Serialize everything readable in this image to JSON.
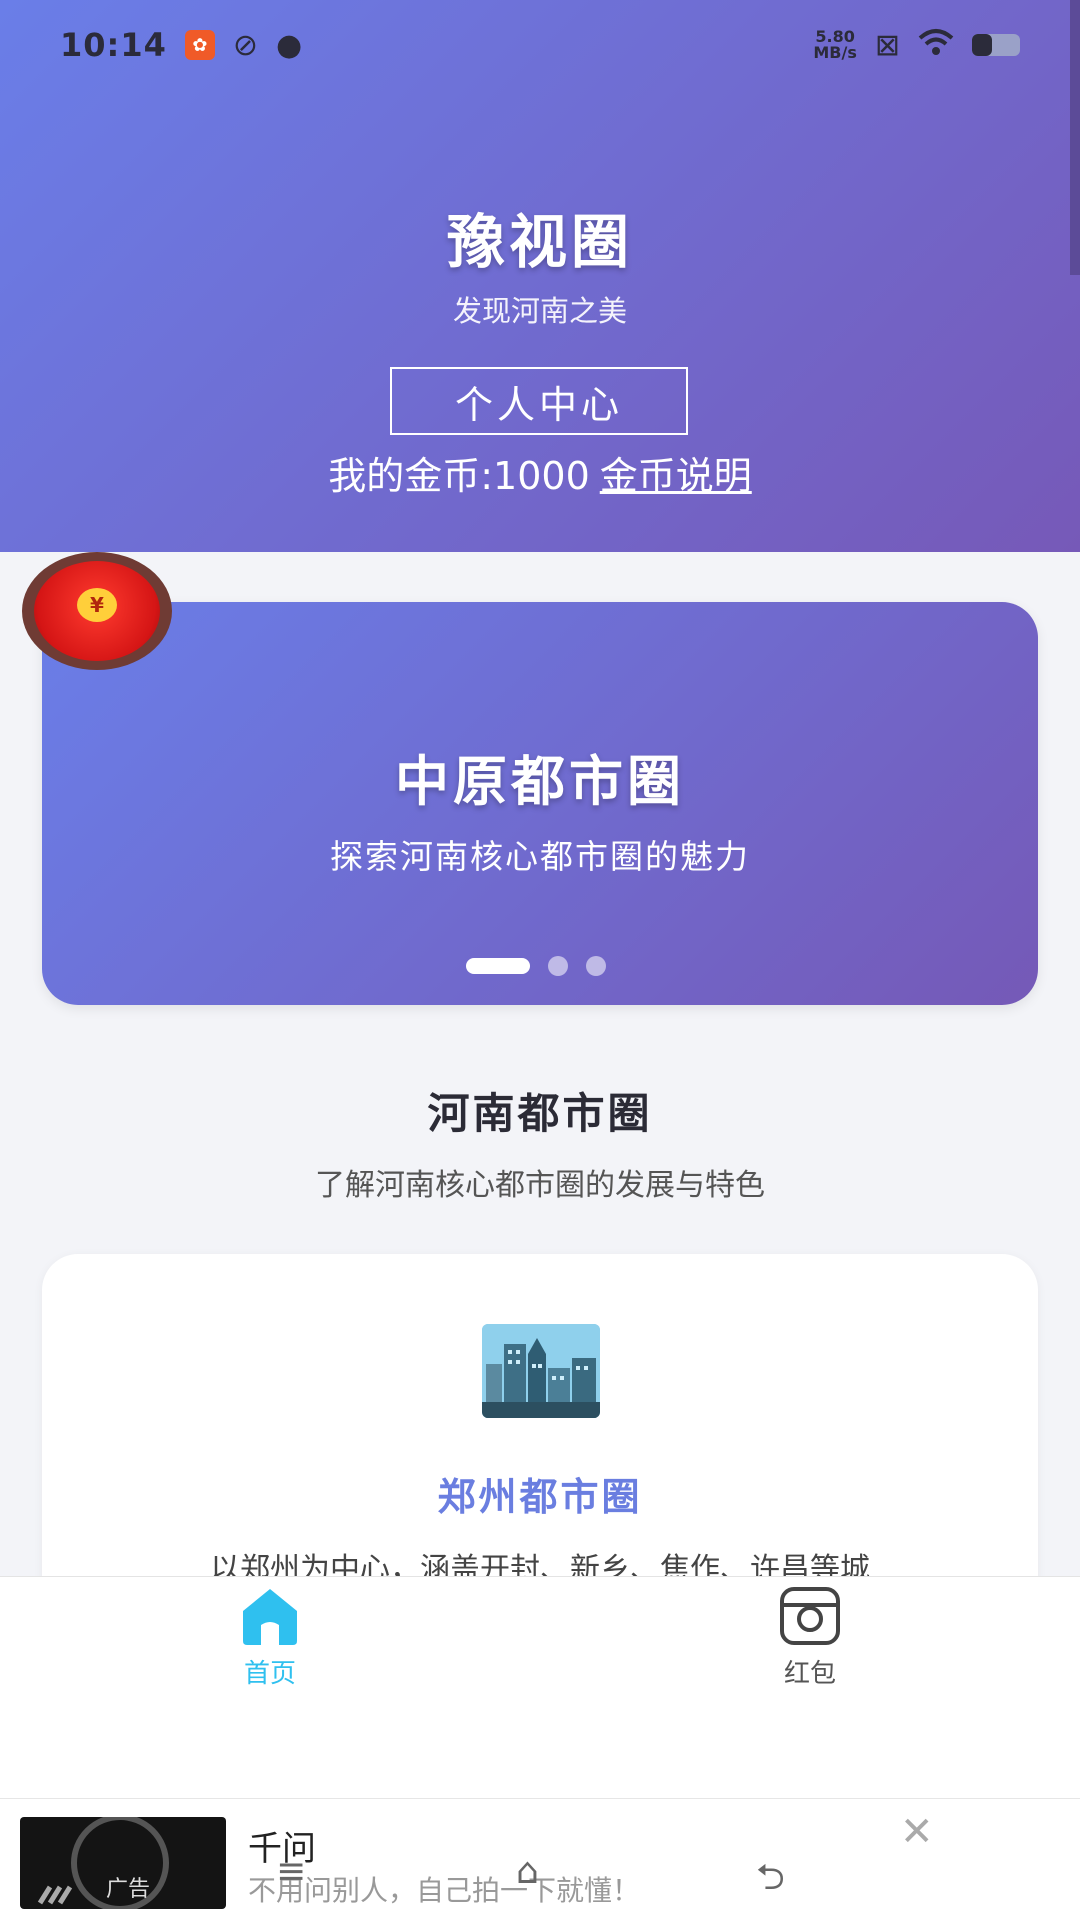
{
  "status_bar": {
    "time": "10:14",
    "net_speed_value": "5.80",
    "net_speed_unit": "MB/s"
  },
  "header": {
    "title": "豫视圈",
    "subtitle": "发现河南之美",
    "personal_center_label": "个人中心",
    "coins_text": "我的金币:1000",
    "coins_help_link": "金币说明"
  },
  "banner": {
    "title": "中原都市圈",
    "subtitle": "探索河南核心都市圈的魅力",
    "active_slide": 1,
    "slide_count": 3
  },
  "redpacket_float": {
    "coin_symbol": "¥"
  },
  "section": {
    "title": "河南都市圈",
    "subtitle": "了解河南核心都市圈的发展与特色"
  },
  "card": {
    "title": "郑州都市圈",
    "description": "以郑州为中心，涵盖开封、新乡、焦作、许昌等城"
  },
  "tabbar": {
    "home_label": "首页",
    "redpacket_label": "红包",
    "active_color": "#2fc0ef"
  },
  "ad": {
    "label": "广告",
    "title": "千问",
    "description": "不用问别人，自己拍一下就懂！"
  },
  "colors": {
    "header_gradient_start": "#6a7ee8",
    "header_gradient_end": "#7659b8",
    "card_title": "#6a7ee0"
  }
}
